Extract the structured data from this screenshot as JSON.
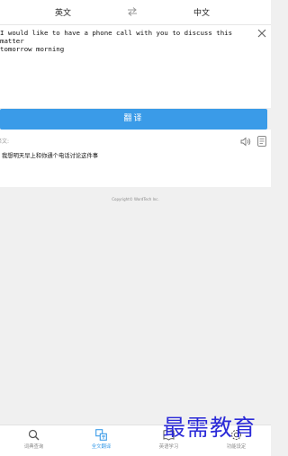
{
  "lang_bar": {
    "source": "英文",
    "target": "中文"
  },
  "input": {
    "text": "I would like to have a phone call with you to discuss this matter\ntomorrow morning"
  },
  "translate_button": "翻译",
  "result": {
    "label": "译文:",
    "text": "我想明天早上和你通个电话讨论这件事"
  },
  "copyright": "Copyright© WordTech Inc.",
  "tabs": [
    {
      "label": "词典查询",
      "icon": "search-icon",
      "active": false
    },
    {
      "label": "全文翻译",
      "icon": "translate-icon",
      "active": true
    },
    {
      "label": "英语学习",
      "icon": "book-icon",
      "active": false
    },
    {
      "label": "功能设定",
      "icon": "settings-icon",
      "active": false
    }
  ],
  "watermark": "最需教育",
  "colors": {
    "accent": "#3a9be8",
    "watermark": "#2b2ad8"
  }
}
